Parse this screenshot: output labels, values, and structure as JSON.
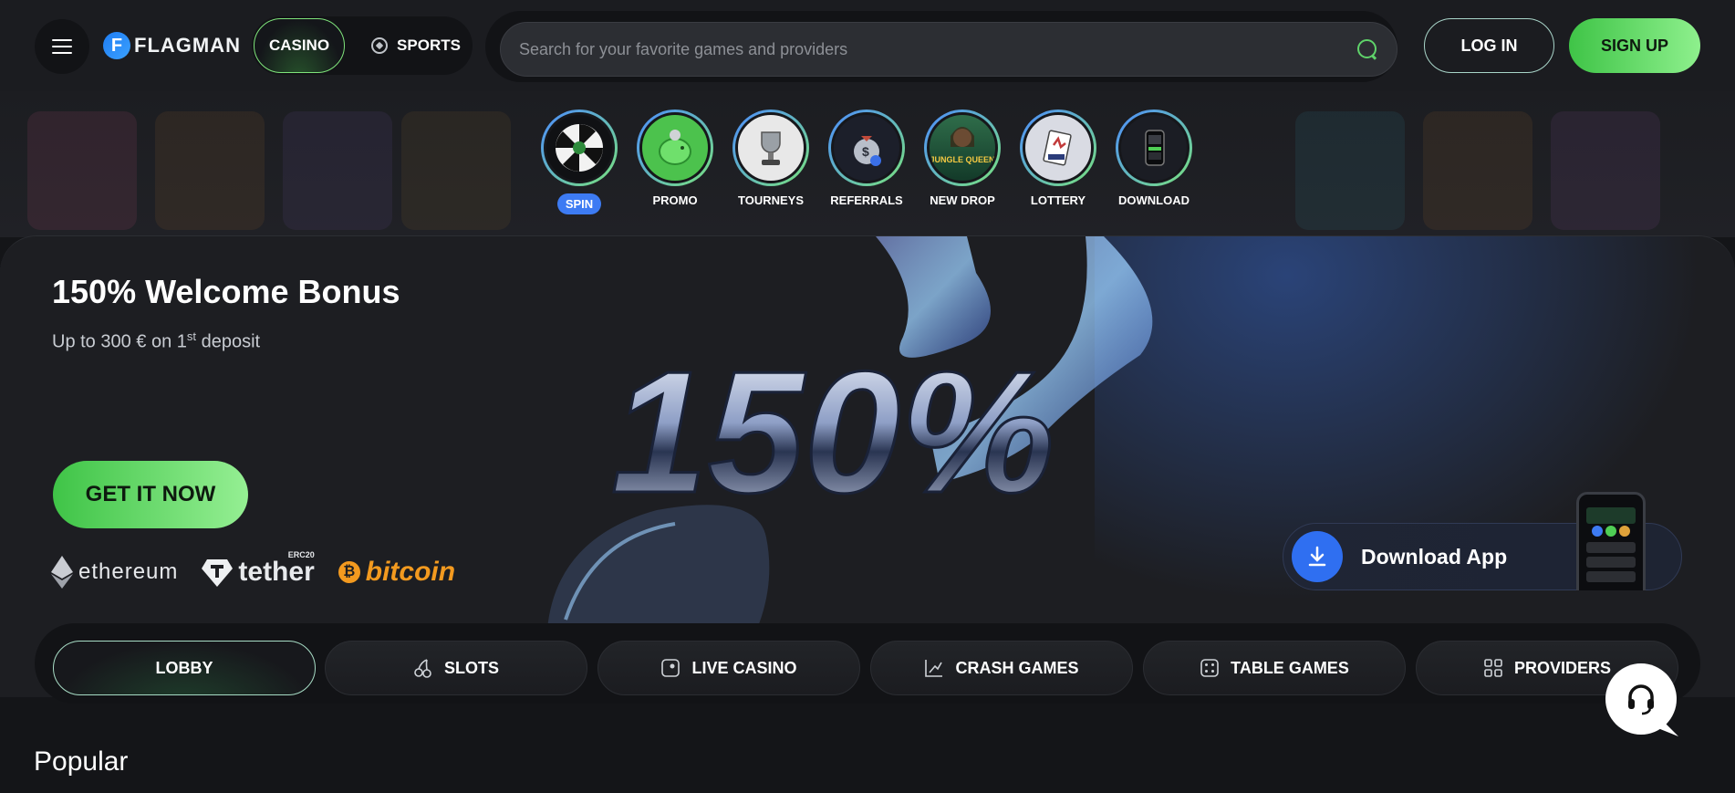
{
  "header": {
    "logo_letter": "F",
    "logo_text": "FLAGMAN",
    "mode_casino": "CASINO",
    "mode_sports": "SPORTS",
    "search_placeholder": "Search for your favorite games and providers",
    "login": "LOG IN",
    "signup": "SIGN UP"
  },
  "shortcuts": [
    {
      "label": "SPIN",
      "icon": "wheel-icon",
      "active": true
    },
    {
      "label": "PROMO",
      "icon": "piggy-bank-icon",
      "active": false
    },
    {
      "label": "TOURNEYS",
      "icon": "trophy-icon",
      "active": false
    },
    {
      "label": "REFERRALS",
      "icon": "money-bag-icon",
      "active": false
    },
    {
      "label": "NEW DROP",
      "icon": "jungle-queen-icon",
      "active": false
    },
    {
      "label": "LOTTERY",
      "icon": "ticket-icon",
      "active": false
    },
    {
      "label": "DOWNLOAD",
      "icon": "phone-icon",
      "active": false
    }
  ],
  "banner": {
    "title": "150% Welcome Bonus",
    "sub_prefix": "Up to 300 € on 1",
    "sub_sup": "st",
    "sub_suffix": " deposit",
    "big_text": "150%",
    "cta": "GET IT NOW",
    "coins": {
      "ethereum": "ethereum",
      "tether": "tether",
      "tether_tag": "ERC20",
      "bitcoin": "bitcoin",
      "bitcoin_symbol": "₿"
    },
    "app_label": "Download App",
    "jungle_queen_text": "JUNGLE QUEEN"
  },
  "tabs": [
    {
      "label": "LOBBY",
      "icon": "none",
      "active": true
    },
    {
      "label": "SLOTS",
      "icon": "cherries-icon",
      "active": false
    },
    {
      "label": "LIVE CASINO",
      "icon": "live-icon",
      "active": false
    },
    {
      "label": "CRASH GAMES",
      "icon": "chart-up-icon",
      "active": false
    },
    {
      "label": "TABLE GAMES",
      "icon": "dice-icon",
      "active": false
    },
    {
      "label": "PROVIDERS",
      "icon": "grid-icon",
      "active": false
    }
  ],
  "section_title": "Popular",
  "colors": {
    "accent_green": "#4fce55",
    "accent_blue": "#3d7bf3",
    "background": "#141518"
  }
}
